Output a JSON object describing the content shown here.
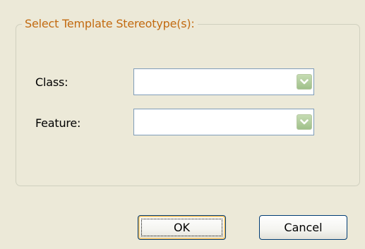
{
  "dialog": {
    "group_title": "Select Template Stereotype(s):",
    "fields": [
      {
        "label": "Class:",
        "value": ""
      },
      {
        "label": "Feature:",
        "value": ""
      }
    ],
    "buttons": {
      "ok_label": "OK",
      "cancel_label": "Cancel"
    }
  },
  "colors": {
    "background": "#ece9d8",
    "group_title": "#c26a10",
    "combo_border": "#7f9db9",
    "dropdown_button": "#9fc08a",
    "button_border": "#003c74"
  },
  "icons": {
    "dropdown": "chevron-down-icon"
  }
}
